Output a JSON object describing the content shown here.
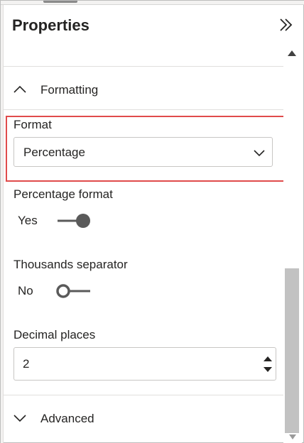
{
  "panel": {
    "title": "Properties",
    "collapse_icon": "double-chevron-right-icon"
  },
  "formatting_section": {
    "label": "Formatting",
    "expanded": true,
    "icon": "chevron-up-icon"
  },
  "format_field": {
    "label": "Format",
    "value": "Percentage",
    "icon": "chevron-down-icon"
  },
  "percentage_format": {
    "label": "Percentage format",
    "state_label": "Yes",
    "on": true
  },
  "thousands_separator": {
    "label": "Thousands separator",
    "state_label": "No",
    "on": false
  },
  "decimal_places": {
    "label": "Decimal places",
    "value": "2"
  },
  "advanced_section": {
    "label": "Advanced",
    "expanded": false,
    "icon": "chevron-down-icon"
  },
  "colors": {
    "highlight": "#e04b4b",
    "toggle": "#5a5a5a",
    "scroll_thumb": "#c2c2c2"
  }
}
